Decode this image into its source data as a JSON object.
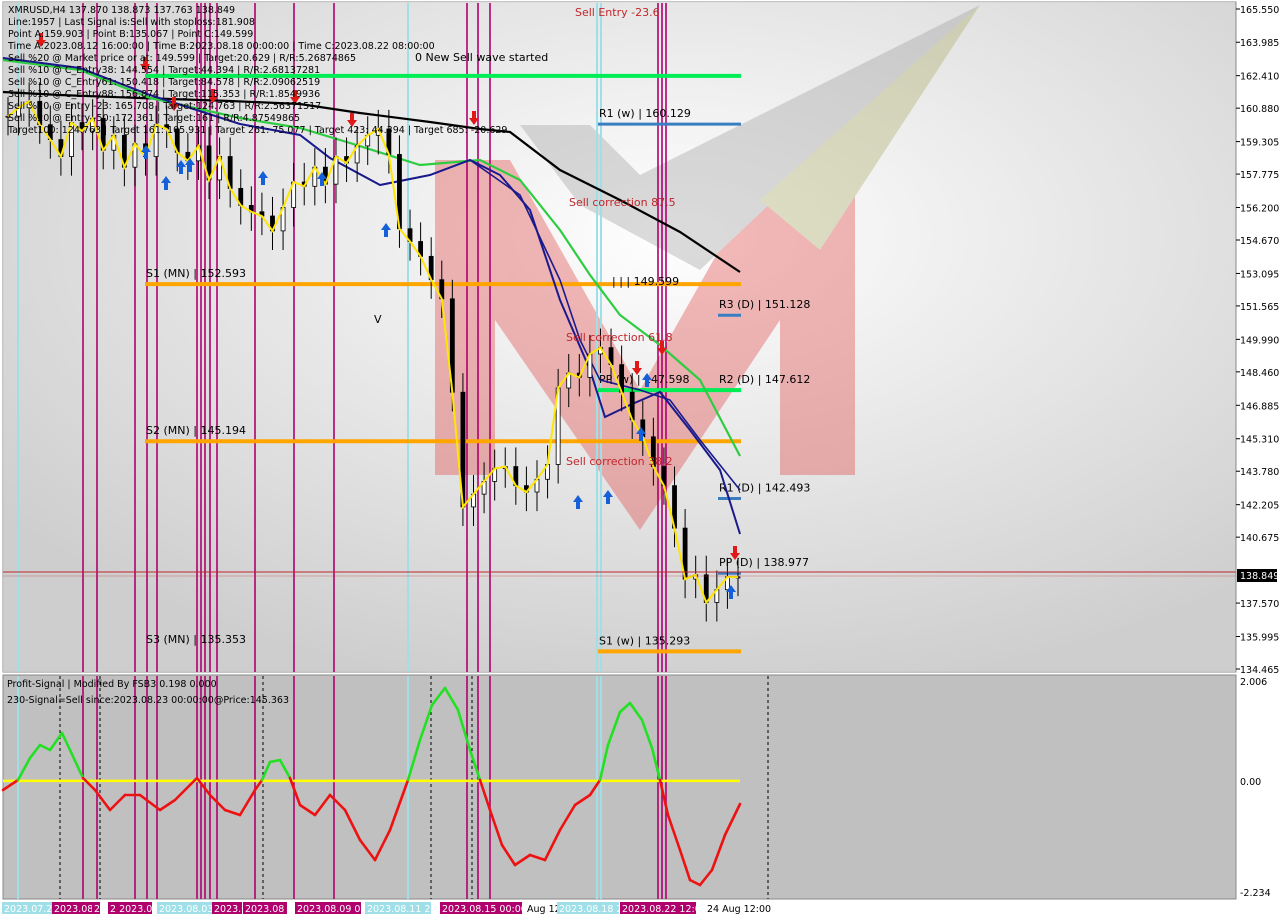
{
  "info_lines": [
    "XMRUSD,H4  137.870 138.873 137.763 138.849",
    "Line:1957 | Last Signal is:Sell with stoploss:181.908",
    "Point A:159.903 | Point B:135.067 | Point C:149.599",
    "Time A:2023.08.12 16:00:00 | Time B:2023.08.18 00:00:00 | Time C:2023.08.22 08:00:00",
    "Sell %20 @ Market price or at: 149.599 | Target:20.629 | R/R:5.26874865",
    "Sell %10 @ C_Entry38: 144.554 | Target:44.394 | R/R:2.68137281",
    "Sell %10 @ C_Entry61: 150.418 | Target:84.578 | R/R:2.09062519",
    "Sell %10 @ C_Entry88: 156.874 | Target:115.353 | R/R:1.8549936",
    "Sell %20 @ Entry -23: 165.708 | Target:124.763 | R/R:2.56371517",
    "Sell %20 @ Entry -50: 172.361 | Target:161 | R/R:4.87549865",
    "Target100: 124.763 | Target 161: 105.931 | Target 261: 75.077 | Target 423: 44.394 | Target 685: -20.629"
  ],
  "annotations": {
    "new_sell_wave": "0 New Sell wave started",
    "sell_entry": "Sell Entry -23.6",
    "sell_corr_875": "Sell correction 87.5",
    "sell_corr_618": "Sell correction 61.8",
    "sell_corr_382": "Sell correction 38.2",
    "point_c": "| | | 149.599",
    "point_v": "V"
  },
  "levels": [
    {
      "label": "R1 (w) | 160.129",
      "price": 160.129,
      "color": "#3a7ec2"
    },
    {
      "label": "S1 (MN) | 152.593",
      "price": 152.593,
      "color": "#ffa500"
    },
    {
      "label": "R3 (D) | 151.128",
      "price": 151.128,
      "color": "#3a7ec2"
    },
    {
      "label": "R2 (D) | 147.612",
      "price": 147.612,
      "color": "#3a7ec2"
    },
    {
      "label": "PP (w) | 147.598",
      "price": 147.598,
      "color": "#00ee55"
    },
    {
      "label": "S2 (MN) | 145.194",
      "price": 145.194,
      "color": "#ffa500"
    },
    {
      "label": "R1 (D) | 142.493",
      "price": 142.493,
      "color": "#3a7ec2"
    },
    {
      "label": "PP (D) | 138.977",
      "price": 138.977,
      "color": "#3a7ec2"
    },
    {
      "label": "S1 (w) | 135.293",
      "price": 135.293,
      "color": "#ffa500"
    },
    {
      "label": "S3 (MN) | 135.353",
      "price": 135.353,
      "color": "#ffa500"
    }
  ],
  "green_top_price": 162.4,
  "current_price": {
    "label": "138.849",
    "value": 138.849
  },
  "y_axis_ticks": [
    "165.550",
    "163.985",
    "162.410",
    "160.880",
    "159.305",
    "157.775",
    "156.200",
    "154.670",
    "153.095",
    "151.565",
    "149.990",
    "148.460",
    "146.885",
    "145.310",
    "143.780",
    "142.205",
    "140.675",
    "137.570",
    "135.995",
    "134.465"
  ],
  "indicator": {
    "title": "Profit-Signal | Modified By FSB3 0.198 0.000",
    "signal": "230-Signal=Sell since:2023.08.23 00:00:00@Price:145.363",
    "ticks": [
      "2.006",
      "0.00",
      "-2.234"
    ],
    "ymax": 2.006,
    "ymin": -2.234
  },
  "x_axis_labels": [
    "2023.07.28 12:00",
    "2023.08.01",
    "2023.08",
    "2 2023.08",
    "2023.08.03 08:00",
    "2023.08.07 04",
    "2023.08",
    "2023.08.09 00:00",
    "2023.08.11 20:00",
    "2023.08.15 00:00",
    "Aug 12",
    "2023.08.18 20",
    "2023.08.22 12:00",
    "24 Aug 12:00"
  ],
  "chart_data": {
    "type": "line",
    "title": "XMRUSD,H4",
    "ylim": [
      134.465,
      165.55
    ],
    "series": [
      {
        "name": "Price",
        "values": [
          160.5,
          160.9,
          161.2,
          160.1,
          159.4,
          158.6,
          160.2,
          159.8,
          160.4,
          158.9,
          159.6,
          158.1,
          159.2,
          158.6,
          160.1,
          159.9,
          158.8,
          158.4,
          159.1,
          157.5,
          158.6,
          157.1,
          156.3,
          156.0,
          155.8,
          155.1,
          156.2,
          157.4,
          157.2,
          158.1,
          157.3,
          158.6,
          158.3,
          159.1,
          159.6,
          159.9,
          158.7,
          155.2,
          154.6,
          153.9,
          152.8,
          151.9,
          147.5,
          142.1,
          142.7,
          143.3,
          143.9,
          144.0,
          143.1,
          142.8,
          143.4,
          144.1,
          147.7,
          148.4,
          148.2,
          149.3,
          149.6,
          148.8,
          147.5,
          146.2,
          145.4,
          144.0,
          143.1,
          141.1,
          138.7,
          138.9,
          137.6,
          138.2,
          138.8,
          138.8
        ]
      }
    ],
    "subchart": {
      "name": "Profit-Signal",
      "ylim": [
        -2.234,
        2.006
      ]
    }
  }
}
